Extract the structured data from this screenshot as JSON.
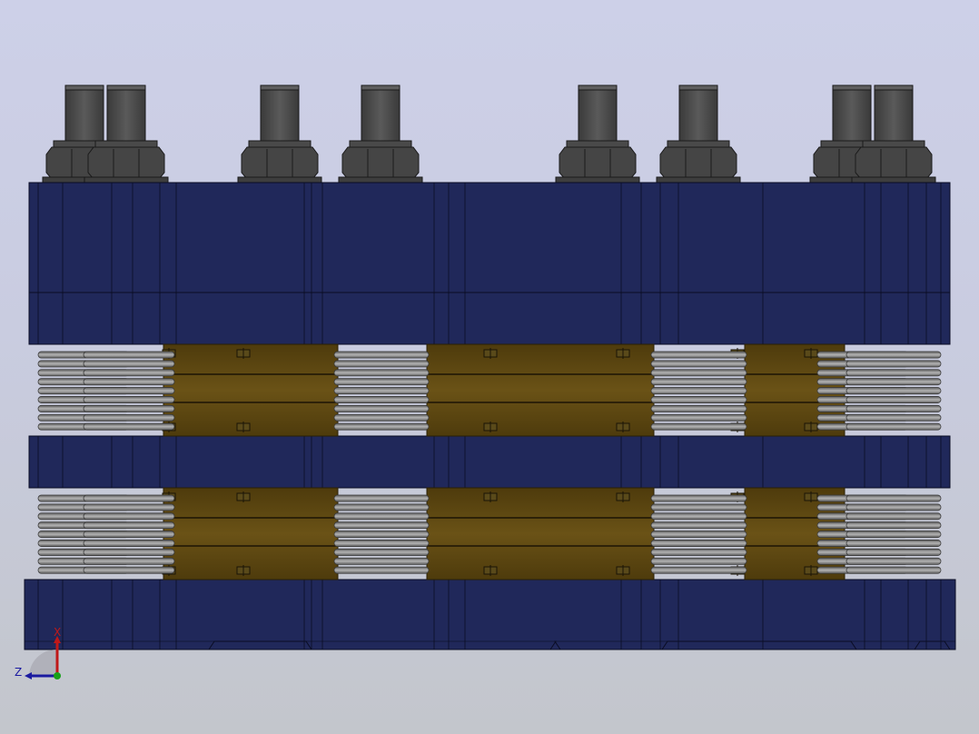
{
  "viewport": {
    "background_top": "#cdd0e8",
    "background_bottom": "#c3c6cc"
  },
  "model": {
    "plate_color": "#20285a",
    "plate_edge_color": "#0a0d24",
    "bushing_color": "#5a4410",
    "spring_color": "#8c8c8c",
    "bolt_color": "#454545"
  },
  "triad": {
    "x_label": "X",
    "z_label": "Z",
    "x_color": "#c01818",
    "z_color": "#1a1aa0",
    "y_color": "#18a018"
  }
}
